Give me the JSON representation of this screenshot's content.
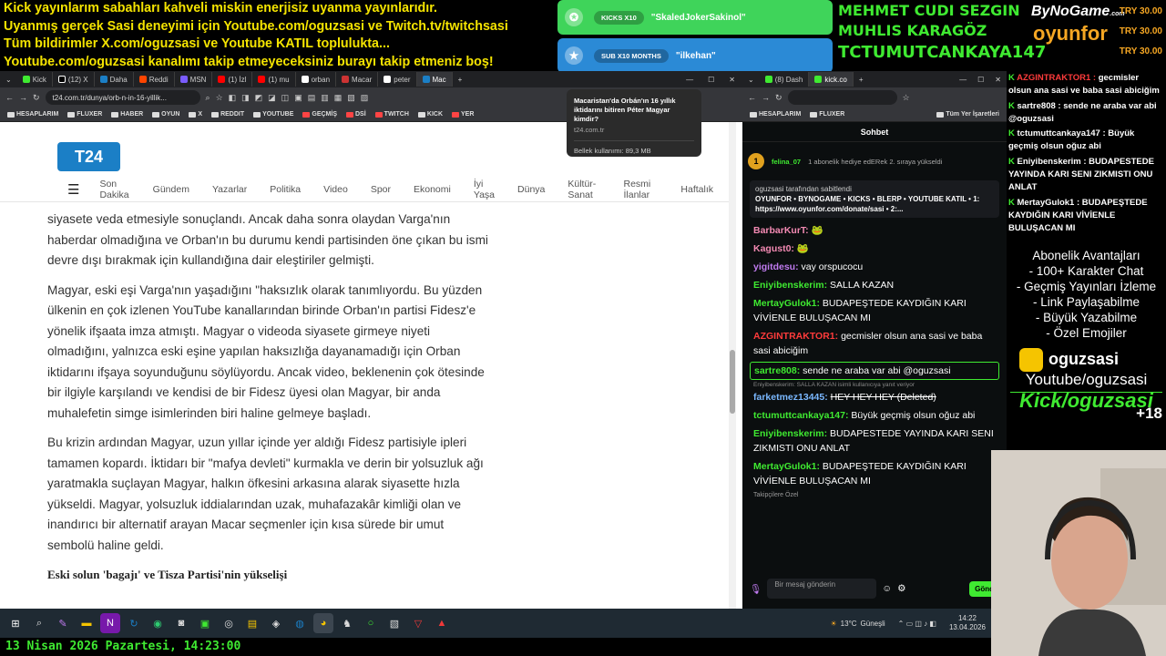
{
  "ticker_top": [
    "Kick yayınlarım sabahları kahveli miskin enerjisiz uyanma yayınlarıdır.",
    "Uyanmış gerçek Sasi deneyimi için Youtube.com/oguzsasi ve Twitch.tv/twitchsasi",
    "Tüm bildirimler X.com/oguzsasi ve Youtube KATIL toplulukta...",
    "Youtube.com/oguzsasi kanalımı takip etmeyeceksiniz burayı takip etmeniz boş!"
  ],
  "notifications": [
    {
      "badge": "KICKS X10",
      "user": "\"SkaledJokerSakinol\""
    },
    {
      "badge": "SUB X10 MONTHS",
      "user": "\"ilkehan\""
    }
  ],
  "supporters": {
    "line1": "MEHMET CUDI SEZGIN",
    "line2": "MUHLIS KARAGÖZ",
    "line3": "TCTUMUTCANKAYA147",
    "brand1": "ByNoGame",
    "brand1_suffix": ".com",
    "brand2": "oyunfor",
    "prices": [
      "TRY 30.00",
      "TRY 30.00",
      "TRY 30.00"
    ]
  },
  "browser_left": {
    "tabs": [
      "Kick",
      "(12) X",
      "Daha",
      "Reddi",
      "MSN",
      "(1) İzl",
      "(1) mu",
      "orban",
      "Macar",
      "peter",
      "Mac"
    ],
    "url": "t24.com.tr/dunya/orb-n-in-16-yillik...",
    "bookmarks": [
      "HESAPLARIM",
      "FLUXER",
      "HABER",
      "OYUN",
      "X",
      "REDDIT",
      "YOUTUBE",
      "GEÇMİŞ",
      "DSİ",
      "TWITCH",
      "KICK",
      "YER"
    ],
    "tooltip": {
      "title": "Macaristan'da Orbán'ın 16 yıllık iktidarını bitiren Péter Magyar kimdir?",
      "domain": "t24.com.tr",
      "memory": "Bellek kullanımı: 89,3 MB"
    },
    "site": {
      "logo": "T24",
      "nav": [
        "Son Dakika",
        "Gündem",
        "Yazarlar",
        "Politika",
        "Video",
        "Spor",
        "Ekonomi",
        "İyi Yaşa",
        "Dünya",
        "Kültür-Sanat",
        "Resmi İlanlar",
        "Haftalık"
      ],
      "paragraphs": [
        "siyasete veda etmesiyle sonuçlandı. Ancak daha sonra olaydan Varga'nın haberdar olmadığına ve Orban'ın bu durumu kendi partisinden öne çıkan bu ismi devre dışı bırakmak için kullandığına dair eleştiriler gelmişti.",
        "Magyar, eski eşi Varga'nın yaşadığını \"haksızlık olarak tanımlıyordu. Bu yüzden ülkenin en çok izlenen YouTube kanallarından birinde Orban'ın partisi Fidesz'e yönelik ifşaata imza atmıştı. Magyar o videoda siyasete girmeye niyeti olmadığını, yalnızca eski eşine yapılan haksızlığa dayanamadığı için Orban iktidarını ifşaya soyunduğunu söylüyordu. Ancak video, beklenenin çok ötesinde bir ilgiyle karşılandı ve kendisi de bir Fidesz üyesi olan Magyar, bir anda muhalefetin simge isimlerinden biri haline gelmeye başladı.",
        "Bu krizin ardından Magyar, uzun yıllar içinde yer aldığı Fidesz partisiyle ipleri tamamen kopardı. İktidarı bir \"mafya devleti\" kurmakla ve derin bir yolsuzluk ağı yaratmakla suçlayan Magyar, halkın öfkesini arkasına alarak siyasette hızla yükseldi. Magyar, yolsuzluk iddialarından uzak, muhafazakâr kimliği olan ve inandırıcı bir alternatif arayan Macar seçmenler için kısa sürede bir umut sembolü haline geldi."
      ],
      "subheading": "Eski solun 'bagajı' ve Tisza Partisi'nin yükselişi"
    }
  },
  "browser_right": {
    "tabs": [
      "(8) Dash",
      "kick.co"
    ],
    "bookmarks": [
      "HESAPLARIM",
      "FLUXER",
      "Tüm Yer İşaretleri"
    ],
    "chat_title": "Sohbet",
    "gift_user": "felina_07",
    "gift_count": "1",
    "gift_text": "1 abonelik hediye edERek 2. sıraya yükseldi",
    "pinned_by": "oguzsasi tarafından sabitlendi",
    "pinned_text": "OYUNFOR • BYNOGAME • KICKS • BLERP • YOUTUBE KATIL • 1: https://www.oyunfor.com/donate/sasi • 2:...",
    "messages": [
      {
        "user": "BarbarKurT:",
        "color": "#f38ab3",
        "text": "🐸"
      },
      {
        "user": "Kagust0:",
        "color": "#f38ab3",
        "text": "🐸"
      },
      {
        "user": "yigitdesu:",
        "color": "#c07bf0",
        "text": "vay orspucocu"
      },
      {
        "user": "Eniyibenskerim:",
        "color": "#3fea31",
        "text": "SALLA KAZAN"
      },
      {
        "user": "MertayGulok1:",
        "color": "#3fea31",
        "text": "BUDAPEŞTEDE KAYDIĞIN KARI VİVİENLE BULUŞACAN MI"
      },
      {
        "user": "AZGINTRAKTOR1:",
        "color": "#ff3b3b",
        "text": "gecmisler olsun ana sasi ve baba sasi abiciğim"
      },
      {
        "user": "sartre808:",
        "color": "#3fea31",
        "text": "sende ne araba var abi @oguzsasi"
      },
      {
        "user": "farketmez13445:",
        "color": "#7ab8ff",
        "text": "HEY HEY HEY (Deleted)"
      },
      {
        "user": "tctumuttcankaya147:",
        "color": "#3fea31",
        "text": "Büyük geçmiş olsun oğuz abi"
      },
      {
        "user": "Eniyibenskerim:",
        "color": "#3fea31",
        "text": "BUDAPESTEDE YAYINDA KARI SENI ZIKMISTI ONU ANLAT"
      },
      {
        "user": "MertayGulok1:",
        "color": "#3fea31",
        "text": "BUDAPEŞTEDE KAYDIĞIN KARI VİVİENLE BULUŞACAN MI"
      }
    ],
    "reply_hint": "Eniyibenskerim: SALLA KAZAN isimli kullanıcıya yanıt veriyor",
    "followers_label": "Takipçilere Özel",
    "input_placeholder": "Bir mesaj gönderin",
    "send_label": "Gönd"
  },
  "overlay": {
    "messages": [
      {
        "user": "AZGINTRAKTOR1 :",
        "color": "#ff3b3b",
        "text": "gecmisler olsun ana sasi ve baba sasi abiciğim"
      },
      {
        "user": "sartre808 :",
        "color": "#fff",
        "text": "sende ne araba var abi @oguzsasi"
      },
      {
        "user": "tctumuttcankaya147 :",
        "color": "#fff",
        "text": "Büyük geçmiş olsun oğuz abi"
      },
      {
        "user": "Eniyibenskerim :",
        "color": "#fff",
        "text": "BUDAPESTEDE YAYINDA KARI SENI ZIKMISTI ONU ANLAT"
      },
      {
        "user": "MertayGulok1 :",
        "color": "#fff",
        "text": "BUDAPEŞTEDE KAYDIĞIN KARI VİVİENLE BULUŞACAN MI"
      }
    ],
    "perks_title": "Abonelik Avantajları",
    "perks": [
      "- 100+ Karakter Chat",
      "- Geçmiş Yayınları İzleme",
      "- Link Paylaşabilme",
      "- Büyük Yazabilme",
      "- Özel Emojiler"
    ],
    "channel": "oguzsasi",
    "youtube": "Youtube/oguzsasi",
    "kick": "Kick/oguzsasi",
    "age": "+18"
  },
  "taskbar": {
    "weather": "13°C",
    "weather_text": "Güneşli",
    "time": "14:22",
    "date": "13.04.2026"
  },
  "bottom_ticker": "13 Nisan 2026 Pazartesi, 14:23:00",
  "colors": {
    "kick_green": "#3fea31",
    "ticker_yellow": "#f5e400",
    "t24_blue": "#1b7fc6"
  }
}
